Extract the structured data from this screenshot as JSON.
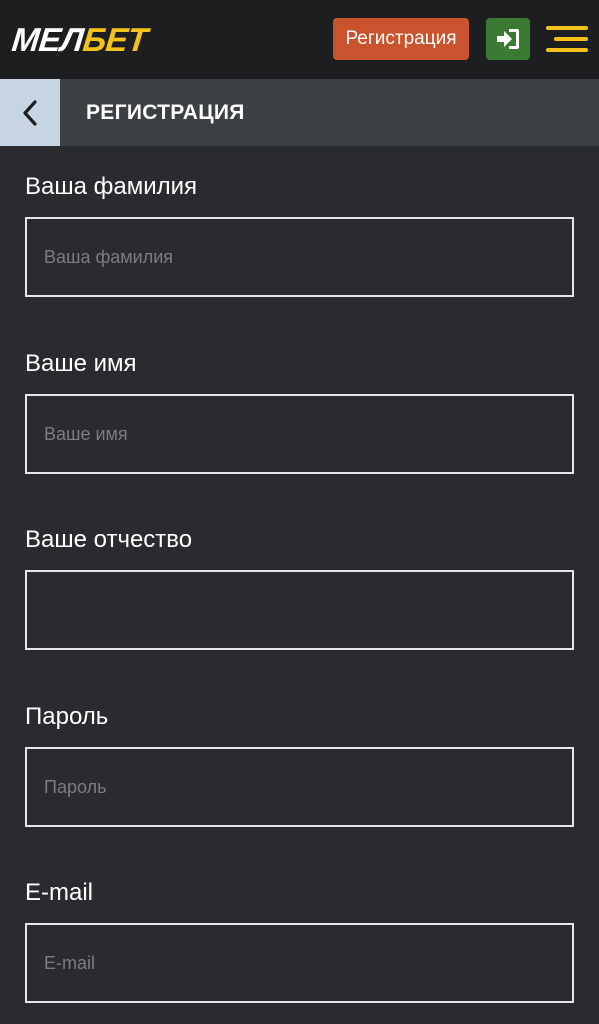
{
  "header": {
    "logo_part1": "МЕЛ",
    "logo_part2": "БЕТ",
    "register_button": "Регистрация",
    "login_icon": "sign-in-icon",
    "menu_icon": "hamburger-menu-icon"
  },
  "subheader": {
    "back_icon": "chevron-left-icon",
    "title": "РЕГИСТРАЦИЯ"
  },
  "form": {
    "fields": [
      {
        "label": "Ваша фамилия",
        "placeholder": "Ваша фамилия",
        "value": ""
      },
      {
        "label": "Ваше имя",
        "placeholder": "Ваше имя",
        "value": ""
      },
      {
        "label": "Ваше отчество",
        "placeholder": "",
        "value": ""
      },
      {
        "label": "Пароль",
        "placeholder": "Пароль",
        "value": ""
      },
      {
        "label": "E-mail",
        "placeholder": "E-mail",
        "value": ""
      }
    ]
  },
  "colors": {
    "brand_yellow": "#f4c21a",
    "register_orange": "#c9532c",
    "login_green": "#3b7a33",
    "background": "#2a2b2e",
    "topbar": "#1d1e20",
    "subbar": "#3c3f44",
    "back_button": "#c7d4e1"
  }
}
